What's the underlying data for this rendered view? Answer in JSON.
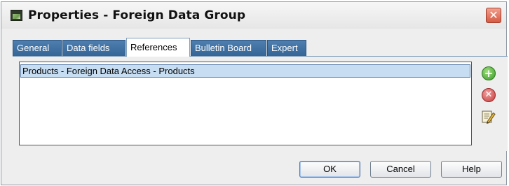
{
  "window": {
    "title": "Properties - Foreign Data Group",
    "close_glyph": "✕"
  },
  "tabs": [
    {
      "label": "General"
    },
    {
      "label": "Data fields"
    },
    {
      "label": "References",
      "active": true
    },
    {
      "label": "Bulletin Board"
    },
    {
      "label": "Expert"
    }
  ],
  "references": {
    "items": [
      "Products - Foreign Data Access - Products"
    ],
    "selected_index": 0
  },
  "side_buttons": {
    "add_icon": "add-icon",
    "add_glyph": "+",
    "remove_icon": "remove-icon",
    "remove_glyph": "✕",
    "edit_icon": "edit-icon"
  },
  "buttons": {
    "ok": "OK",
    "cancel": "Cancel",
    "help": "Help"
  },
  "colors": {
    "tab_inactive": "#3a6b9b",
    "selection": "#c6ddf2",
    "close": "#d65a42"
  }
}
